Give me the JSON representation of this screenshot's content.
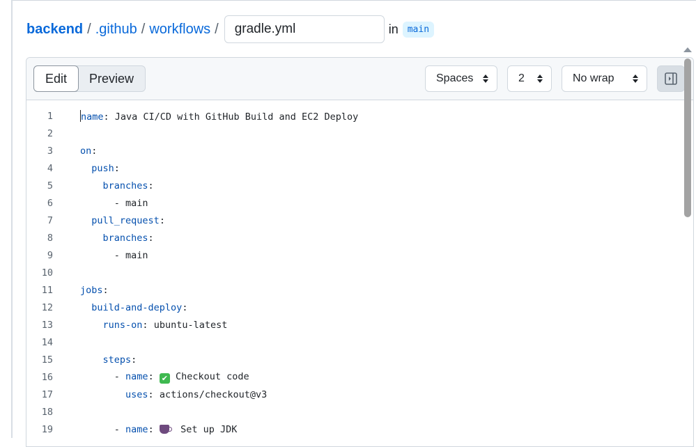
{
  "breadcrumb": {
    "repo": "backend",
    "sep": "/",
    "folder1": ".github",
    "folder2": "workflows",
    "filename": "gradle.yml",
    "in_label": "in",
    "branch": "main"
  },
  "toolbar": {
    "tabs": [
      {
        "label": "Edit",
        "active": true
      },
      {
        "label": "Preview",
        "active": false
      }
    ],
    "indent_mode": "Spaces",
    "indent_size": "2",
    "wrap_mode": "No wrap",
    "panel_icon": "sidebar-expand-icon"
  },
  "editor": {
    "lines": [
      {
        "n": "1",
        "indent": "",
        "key": "name",
        "sep": ": ",
        "value": "Java CI/CD with GitHub Build and EC2 Deploy",
        "cursor": true
      },
      {
        "n": "2",
        "indent": "",
        "key": "",
        "sep": "",
        "value": ""
      },
      {
        "n": "3",
        "indent": "",
        "key": "on",
        "sep": ":",
        "value": ""
      },
      {
        "n": "4",
        "indent": "  ",
        "key": "push",
        "sep": ":",
        "value": ""
      },
      {
        "n": "5",
        "indent": "    ",
        "key": "branches",
        "sep": ":",
        "value": ""
      },
      {
        "n": "6",
        "indent": "      ",
        "key": "",
        "sep": "",
        "value": "- main"
      },
      {
        "n": "7",
        "indent": "  ",
        "key": "pull_request",
        "sep": ":",
        "value": ""
      },
      {
        "n": "8",
        "indent": "    ",
        "key": "branches",
        "sep": ":",
        "value": ""
      },
      {
        "n": "9",
        "indent": "      ",
        "key": "",
        "sep": "",
        "value": "- main"
      },
      {
        "n": "10",
        "indent": "",
        "key": "",
        "sep": "",
        "value": ""
      },
      {
        "n": "11",
        "indent": "",
        "key": "jobs",
        "sep": ":",
        "value": ""
      },
      {
        "n": "12",
        "indent": "  ",
        "key": "build-and-deploy",
        "sep": ":",
        "value": ""
      },
      {
        "n": "13",
        "indent": "    ",
        "key": "runs-on",
        "sep": ": ",
        "value": "ubuntu-latest"
      },
      {
        "n": "14",
        "indent": "",
        "key": "",
        "sep": "",
        "value": ""
      },
      {
        "n": "15",
        "indent": "    ",
        "key": "steps",
        "sep": ":",
        "value": ""
      },
      {
        "n": "16",
        "indent": "      ",
        "dash": "- ",
        "key": "name",
        "sep": ": ",
        "emoji": "check",
        "value": "Checkout code"
      },
      {
        "n": "17",
        "indent": "        ",
        "key": "uses",
        "sep": ": ",
        "value": "actions/checkout@v3"
      },
      {
        "n": "18",
        "indent": "",
        "key": "",
        "sep": "",
        "value": ""
      },
      {
        "n": "19",
        "indent": "      ",
        "dash": "- ",
        "key": "name",
        "sep": ": ",
        "emoji": "cup",
        "value": "Set up JDK"
      }
    ]
  }
}
